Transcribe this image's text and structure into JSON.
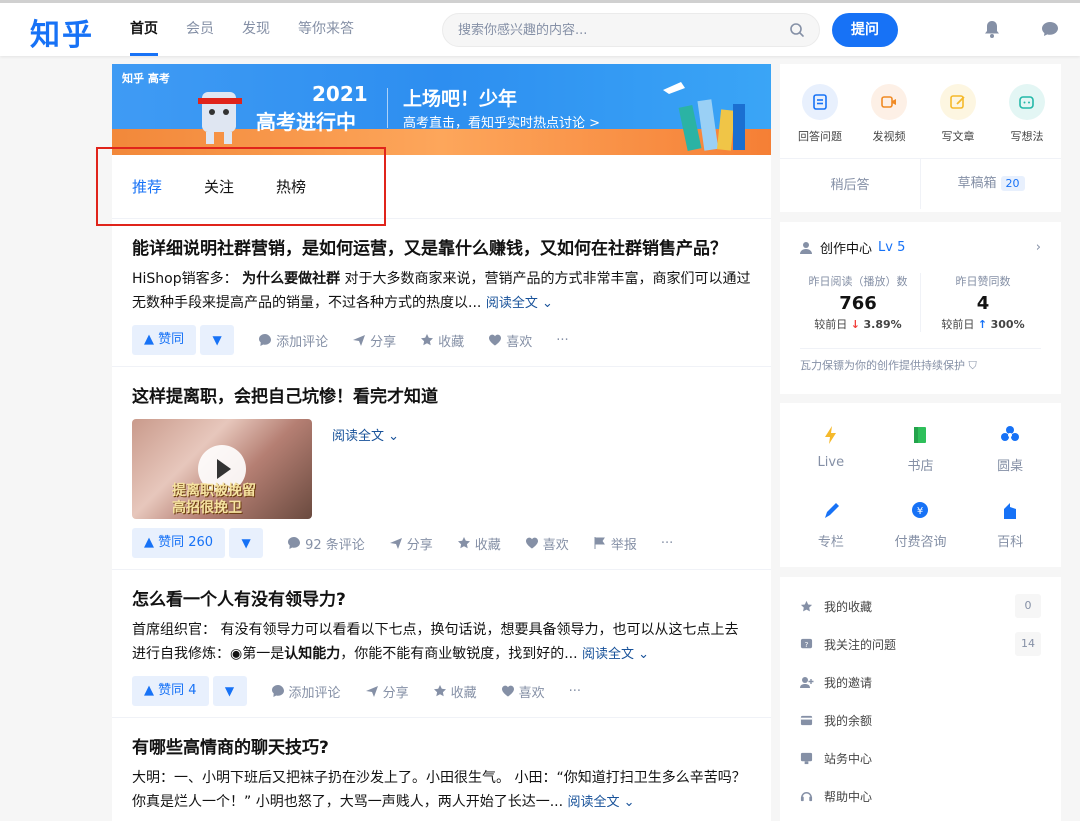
{
  "header": {
    "logo": "知乎",
    "nav": [
      "首页",
      "会员",
      "发现",
      "等你来答"
    ],
    "search_placeholder": "搜索你感兴趣的内容...",
    "ask_label": "提问"
  },
  "banner": {
    "tag": "知乎 高考",
    "year": "2021",
    "headline": "高考进行中",
    "title": "上场吧！少年",
    "subtitle": "高考直击，看知乎实时热点讨论 >"
  },
  "tabs": [
    "推荐",
    "关注",
    "热榜"
  ],
  "feed": [
    {
      "title": "能详细说明社群营销，是如何运营，又是靠什么赚钱，又如何在社群销售产品？",
      "author": "HiShop销客多：",
      "bold": "为什么要做社群",
      "excerpt": "对于大多数商家来说，营销产品的方式非常丰富，商家们可以通过无数种手段来提高产品的销量，不过各种方式的热度以...",
      "read_more": "阅读全文 ⌄",
      "vote": "▲ 赞同",
      "comment": "添加评论",
      "share": "分享",
      "collect": "收藏",
      "like": "喜欢",
      "more": "···"
    },
    {
      "title": "这样提离职，会把自己坑惨！看完才知道",
      "thumb_caption": "提离职被挽留\n高招很挽卫",
      "read_more": "阅读全文 ⌄",
      "vote": "▲ 赞同 260",
      "comment": "92 条评论",
      "share": "分享",
      "collect": "收藏",
      "like": "喜欢",
      "report": "举报",
      "more": "···"
    },
    {
      "title": "怎么看一个人有没有领导力?",
      "author": "首席组织官：",
      "excerpt": "有没有领导力可以看看以下七点，换句话说，想要具备领导力，也可以从这七点上去进行自我修炼：◉第一是",
      "bold": "认知能力",
      "excerpt2": "，你能不能有商业敏锐度，找到好的...",
      "read_more": "阅读全文 ⌄",
      "vote": "▲ 赞同 4",
      "comment": "添加评论",
      "share": "分享",
      "collect": "收藏",
      "like": "喜欢",
      "more": "···"
    },
    {
      "title": "有哪些高情商的聊天技巧?",
      "excerpt": "大明：一、小明下班后又把袜子扔在沙发上了。小田很生气。 小田：“你知道打扫卫生多么辛苦吗？你真是烂人一个！” 小明也怒了，大骂一声贱人，两人开始了长达一...",
      "read_more": "阅读全文 ⌄"
    }
  ],
  "creator_actions": [
    "回答问题",
    "发视频",
    "写文章",
    "写想法"
  ],
  "draft": {
    "later": "稍后答",
    "box": "草稿箱",
    "box_count": "20"
  },
  "creator_center": {
    "title": "创作中心",
    "level": "Lv 5",
    "stat1_label": "昨日阅读（播放）数",
    "stat1_value": "766",
    "stat1_delta_label": "较前日",
    "stat1_delta": "3.89%",
    "stat2_label": "昨日赞同数",
    "stat2_value": "4",
    "stat2_delta_label": "较前日",
    "stat2_delta": "300%",
    "footer": "瓦力保镖为你的创作提供持续保护"
  },
  "services": [
    "Live",
    "书店",
    "圆桌",
    "专栏",
    "付费咨询",
    "百科"
  ],
  "sidebar_list": [
    {
      "label": "我的收藏",
      "count": "0"
    },
    {
      "label": "我关注的问题",
      "count": "14"
    },
    {
      "label": "我的邀请",
      "count": ""
    },
    {
      "label": "我的余额",
      "count": ""
    },
    {
      "label": "站务中心",
      "count": ""
    },
    {
      "label": "帮助中心",
      "count": ""
    }
  ],
  "colors": {
    "brand": "#1772f6",
    "muted": "#8590a6",
    "highlight": "#e0241b"
  }
}
